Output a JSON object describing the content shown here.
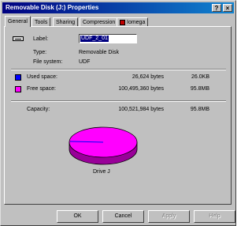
{
  "window": {
    "title": "Removable Disk (J:) Properties"
  },
  "titlebar_buttons": {
    "help": "?",
    "close": "×"
  },
  "tabs": [
    {
      "label": "General"
    },
    {
      "label": "Tools"
    },
    {
      "label": "Sharing"
    },
    {
      "label": "Compression"
    },
    {
      "label": "Iomega"
    }
  ],
  "general": {
    "label_caption": "Label:",
    "label_value": "UDF_2_01",
    "type_caption": "Type:",
    "type_value": "Removable Disk",
    "fs_caption": "File system:",
    "fs_value": "UDF",
    "used_caption": "Used space:",
    "used_bytes": "26,624 bytes",
    "used_short": "26.0KB",
    "free_caption": "Free space:",
    "free_bytes": "100,495,360 bytes",
    "free_short": "95.8MB",
    "capacity_caption": "Capacity:",
    "capacity_bytes": "100,521,984 bytes",
    "capacity_short": "95.8MB",
    "drive_label": "Drive J"
  },
  "colors": {
    "used": "#0000ff",
    "free": "#ff00ff",
    "title_bar": "#000080",
    "face": "#c0c0c0"
  },
  "pie": {
    "used_fraction": 0.00026
  },
  "buttons": {
    "ok": "OK",
    "cancel": "Cancel",
    "apply": "Apply",
    "help": "Help"
  }
}
